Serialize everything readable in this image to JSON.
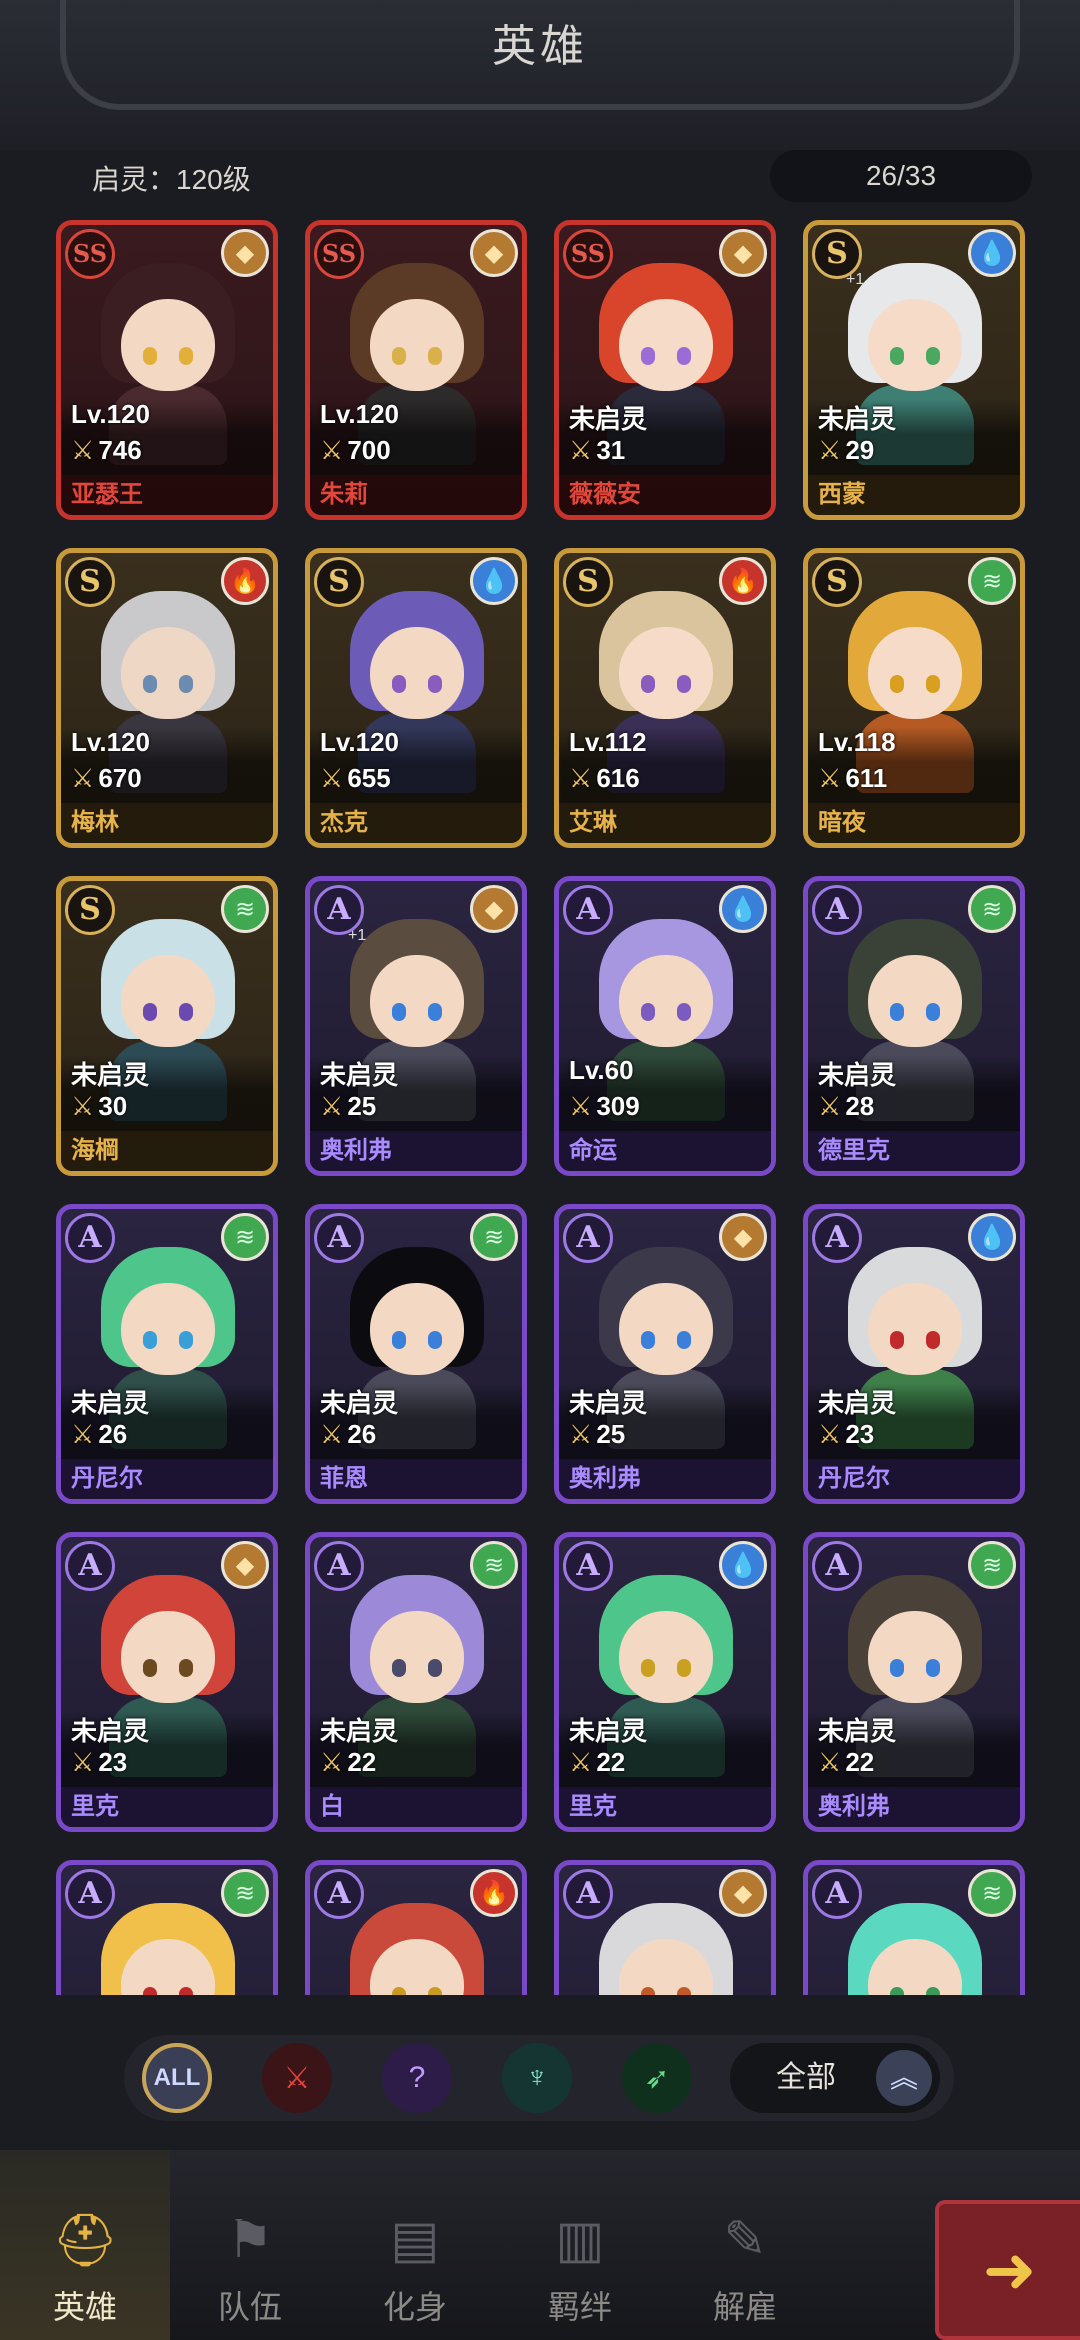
{
  "header": {
    "title": "英雄"
  },
  "summary": {
    "level_text": "启灵：120级",
    "count": "26/33"
  },
  "colors": {
    "ss_border": "#c6342b",
    "s_border": "#c99a3a",
    "a_border": "#7a49c7",
    "accent_gold": "#e5b341"
  },
  "heroes": [
    {
      "rarity": "SS",
      "element": "earth",
      "level": "Lv.120",
      "power": "746",
      "name": "亚瑟王",
      "locked": true,
      "plus": "",
      "hair": "#3a1e22",
      "skin": "#f3d9c4",
      "eye": "#e2b03a",
      "body": "#4a2a2e"
    },
    {
      "rarity": "SS",
      "element": "earth",
      "level": "Lv.120",
      "power": "700",
      "name": "朱莉",
      "locked": true,
      "plus": "",
      "hair": "#5b3b26",
      "skin": "#f3d9c4",
      "eye": "#d9b04a",
      "body": "#2c2a2a"
    },
    {
      "rarity": "SS",
      "element": "earth",
      "level": "未启灵",
      "power": "31",
      "name": "薇薇安",
      "locked": false,
      "plus": "",
      "hair": "#d9452a",
      "skin": "#f6dcc8",
      "eye": "#9b6bd6",
      "body": "#2a2a3a"
    },
    {
      "rarity": "S",
      "element": "water",
      "level": "未启灵",
      "power": "29",
      "name": "西蒙",
      "locked": false,
      "plus": "+1",
      "hair": "#e6e8ea",
      "skin": "#f6dcc8",
      "eye": "#4aa860",
      "body": "#3e7f74"
    },
    {
      "rarity": "S",
      "element": "fire",
      "level": "Lv.120",
      "power": "670",
      "name": "梅林",
      "locked": true,
      "plus": "",
      "hair": "#c9c9cc",
      "skin": "#efd7c6",
      "eye": "#6b8bb0",
      "body": "#3a3640"
    },
    {
      "rarity": "S",
      "element": "water",
      "level": "Lv.120",
      "power": "655",
      "name": "杰克",
      "locked": true,
      "plus": "",
      "hair": "#6c5cb8",
      "skin": "#f3d9c4",
      "eye": "#8a5cc0",
      "body": "#33385a"
    },
    {
      "rarity": "S",
      "element": "fire",
      "level": "Lv.112",
      "power": "616",
      "name": "艾琳",
      "locked": false,
      "plus": "",
      "hair": "#d9c49e",
      "skin": "#f6dcc8",
      "eye": "#8a5cc0",
      "body": "#3a2f55"
    },
    {
      "rarity": "S",
      "element": "wind",
      "level": "Lv.118",
      "power": "611",
      "name": "暗夜",
      "locked": true,
      "plus": "",
      "hair": "#e2a93a",
      "skin": "#f6dcc8",
      "eye": "#d9a020",
      "body": "#b45a22"
    },
    {
      "rarity": "S",
      "element": "wind",
      "level": "未启灵",
      "power": "30",
      "name": "海棡",
      "locked": false,
      "plus": "",
      "hair": "#c9e0e6",
      "skin": "#f3d9c4",
      "eye": "#6b4ab0",
      "body": "#2d4b55"
    },
    {
      "rarity": "A",
      "element": "earth",
      "level": "未启灵",
      "power": "25",
      "name": "奥利弗",
      "locked": false,
      "plus": "+1",
      "hair": "#5a4c3e",
      "skin": "#f3d9c4",
      "eye": "#3a7fd9",
      "body": "#4a4a5a"
    },
    {
      "rarity": "A",
      "element": "water",
      "level": "Lv.60",
      "power": "309",
      "name": "命运",
      "locked": false,
      "plus": "",
      "hair": "#a796e0",
      "skin": "#f3d9c4",
      "eye": "#7a5cc0",
      "body": "#2f4a3a"
    },
    {
      "rarity": "A",
      "element": "wind",
      "level": "未启灵",
      "power": "28",
      "name": "德里克",
      "locked": false,
      "plus": "",
      "hair": "#3a4238",
      "skin": "#f3d9c4",
      "eye": "#3a7fd9",
      "body": "#4a4a5a"
    },
    {
      "rarity": "A",
      "element": "wind",
      "level": "未启灵",
      "power": "26",
      "name": "丹尼尔",
      "locked": false,
      "plus": "",
      "hair": "#4ec58a",
      "skin": "#f3d9c4",
      "eye": "#3a9fd9",
      "body": "#2f4f4a"
    },
    {
      "rarity": "A",
      "element": "wind",
      "level": "未启灵",
      "power": "26",
      "name": "菲恩",
      "locked": false,
      "plus": "",
      "hair": "#0c0c10",
      "skin": "#f3d9c4",
      "eye": "#3a7fd9",
      "body": "#4a4a5a"
    },
    {
      "rarity": "A",
      "element": "earth",
      "level": "未启灵",
      "power": "25",
      "name": "奥利弗",
      "locked": false,
      "plus": "",
      "hair": "#3c3a4a",
      "skin": "#f3d9c4",
      "eye": "#3a7fd9",
      "body": "#4a4a5a"
    },
    {
      "rarity": "A",
      "element": "water",
      "level": "未启灵",
      "power": "23",
      "name": "丹尼尔",
      "locked": false,
      "plus": "",
      "hair": "#d9dadc",
      "skin": "#f3d9c4",
      "eye": "#c02a2a",
      "body": "#3e7f4a"
    },
    {
      "rarity": "A",
      "element": "earth",
      "level": "未启灵",
      "power": "23",
      "name": "里克",
      "locked": false,
      "plus": "",
      "hair": "#d1443a",
      "skin": "#f3d9c4",
      "eye": "#6b4a20",
      "body": "#2f5a52"
    },
    {
      "rarity": "A",
      "element": "wind",
      "level": "未启灵",
      "power": "22",
      "name": "白",
      "locked": false,
      "plus": "",
      "hair": "#9c8ad9",
      "skin": "#f3d9c4",
      "eye": "#4a4a6a",
      "body": "#2f4a3a"
    },
    {
      "rarity": "A",
      "element": "water",
      "level": "未启灵",
      "power": "22",
      "name": "里克",
      "locked": false,
      "plus": "",
      "hair": "#4ec58a",
      "skin": "#f3d9c4",
      "eye": "#c9a020",
      "body": "#2f5a52"
    },
    {
      "rarity": "A",
      "element": "wind",
      "level": "未启灵",
      "power": "22",
      "name": "奥利弗",
      "locked": false,
      "plus": "",
      "hair": "#4a4238",
      "skin": "#f3d9c4",
      "eye": "#3a7fd9",
      "body": "#4a4a5a"
    },
    {
      "rarity": "A",
      "element": "wind",
      "level": "",
      "power": "",
      "name": "",
      "locked": false,
      "plus": "",
      "hair": "#f0c04a",
      "skin": "#f3d9c4",
      "eye": "#c02a2a",
      "body": "#3a3a4a"
    },
    {
      "rarity": "A",
      "element": "fire",
      "level": "",
      "power": "",
      "name": "",
      "locked": false,
      "plus": "",
      "hair": "#c94a3a",
      "skin": "#f3d9c4",
      "eye": "#c99a20",
      "body": "#3a3a4a"
    },
    {
      "rarity": "A",
      "element": "earth",
      "level": "",
      "power": "",
      "name": "",
      "locked": false,
      "plus": "",
      "hair": "#d9d9dc",
      "skin": "#f3d9c4",
      "eye": "#c05a2a",
      "body": "#3a3a4a"
    },
    {
      "rarity": "A",
      "element": "wind",
      "level": "",
      "power": "",
      "name": "",
      "locked": false,
      "plus": "",
      "hair": "#5ad9c0",
      "skin": "#f3d9c4",
      "eye": "#3a9a5a",
      "body": "#3a3a4a"
    }
  ],
  "filters": {
    "all_label": "ALL",
    "items": [
      "warrior-class",
      "mystic-class",
      "support-class",
      "ranger-class"
    ],
    "sort_label": "全部",
    "sort_arrow": "︽"
  },
  "nav": [
    {
      "label": "英雄",
      "icon": "helmet-icon",
      "glyph": "⛑",
      "active": true
    },
    {
      "label": "队伍",
      "icon": "banner-icon",
      "glyph": "⚑",
      "active": false
    },
    {
      "label": "化身",
      "icon": "cards-icon",
      "glyph": "▤",
      "active": false
    },
    {
      "label": "羁绊",
      "icon": "book-icon",
      "glyph": "▥",
      "active": false
    },
    {
      "label": "解雇",
      "icon": "scroll-icon",
      "glyph": "✎",
      "active": false
    }
  ],
  "next_arrow": "➜"
}
